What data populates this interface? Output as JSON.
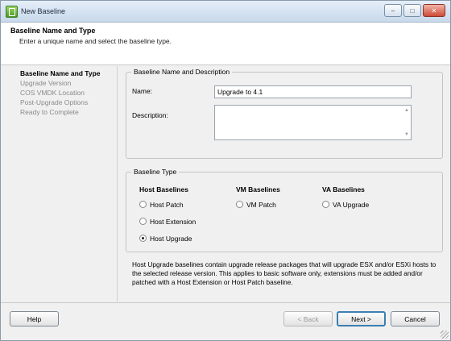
{
  "window": {
    "title": "New Baseline",
    "controls": {
      "minimize": "–",
      "maximize": "□",
      "close": "✕"
    }
  },
  "header": {
    "title": "Baseline Name and Type",
    "subtitle": "Enter a unique name and select the baseline type."
  },
  "nav": {
    "items": [
      {
        "label": "Baseline Name and Type",
        "active": true
      },
      {
        "label": "Upgrade Version",
        "active": false
      },
      {
        "label": "COS VMDK Location",
        "active": false
      },
      {
        "label": "Post-Upgrade Options",
        "active": false
      },
      {
        "label": "Ready to Complete",
        "active": false
      }
    ]
  },
  "name_group": {
    "legend": "Baseline Name and Description",
    "name_label": "Name:",
    "name_value": "Upgrade to 4.1",
    "description_label": "Description:",
    "description_value": ""
  },
  "type_group": {
    "legend": "Baseline Type",
    "columns": [
      {
        "heading": "Host Baselines",
        "options": [
          {
            "label": "Host Patch",
            "checked": false
          },
          {
            "label": "Host Extension",
            "checked": false
          },
          {
            "label": "Host Upgrade",
            "checked": true
          }
        ]
      },
      {
        "heading": "VM Baselines",
        "options": [
          {
            "label": "VM Patch",
            "checked": false
          }
        ]
      },
      {
        "heading": "VA Baselines",
        "options": [
          {
            "label": "VA Upgrade",
            "checked": false
          }
        ]
      }
    ]
  },
  "info_text": "Host Upgrade baselines contain upgrade release packages that will upgrade ESX and/or ESXi hosts to the selected release version. This applies to basic software only, extensions must be added and/or patched with a Host Extension or Host Patch baseline.",
  "footer": {
    "help": "Help",
    "back": "< Back",
    "next": "Next >",
    "cancel": "Cancel"
  }
}
